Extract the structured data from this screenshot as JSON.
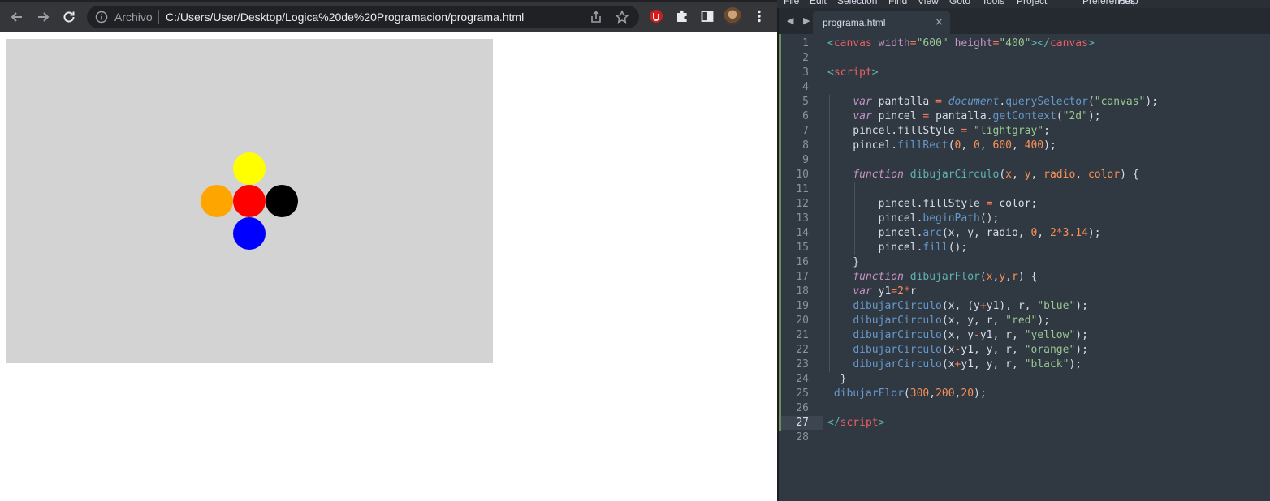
{
  "browser": {
    "omnibox": {
      "scheme_label": "Archivo",
      "url": "C:/Users/User/Desktop/Logica%20de%20Programacion/programa.html"
    },
    "canvas": {
      "background": "#d3d3d3",
      "circles": [
        {
          "name": "blue",
          "color": "#0000ff"
        },
        {
          "name": "red",
          "color": "#ff0000"
        },
        {
          "name": "yellow",
          "color": "#ffff00"
        },
        {
          "name": "orange",
          "color": "#ffa500"
        },
        {
          "name": "black",
          "color": "#000000"
        }
      ]
    }
  },
  "editor": {
    "menu": [
      "File",
      "Edit",
      "Selection",
      "Find",
      "View",
      "Goto",
      "Tools",
      "Project",
      "Preferences",
      "Help"
    ],
    "nav_arrows": "◀ ▶",
    "tab": {
      "name": "programa.html",
      "close": "×"
    },
    "active_line": 27,
    "lines": [
      {
        "n": "1",
        "tokens": [
          [
            "ang",
            "<"
          ],
          [
            "tagname",
            "canvas"
          ],
          [
            "pl",
            " "
          ],
          [
            "attr",
            "width"
          ],
          [
            "op",
            "="
          ],
          [
            "str",
            "\"600\""
          ],
          [
            "pl",
            " "
          ],
          [
            "attr",
            "height"
          ],
          [
            "op",
            "="
          ],
          [
            "str",
            "\"400\""
          ],
          [
            "ang",
            "></"
          ],
          [
            "tagname",
            "canvas"
          ],
          [
            "ang",
            ">"
          ]
        ]
      },
      {
        "n": "2",
        "tokens": []
      },
      {
        "n": "3",
        "tokens": [
          [
            "ang",
            "<"
          ],
          [
            "tagname",
            "script"
          ],
          [
            "ang",
            ">"
          ]
        ]
      },
      {
        "n": "4",
        "tokens": []
      },
      {
        "n": "5",
        "tokens": [
          [
            "pl",
            "    "
          ],
          [
            "kw",
            "var"
          ],
          [
            "pl",
            " pantalla "
          ],
          [
            "op",
            "="
          ],
          [
            "pl",
            " "
          ],
          [
            "dom",
            "document"
          ],
          [
            "pun",
            "."
          ],
          [
            "fn",
            "querySelector"
          ],
          [
            "pun",
            "("
          ],
          [
            "str",
            "\"canvas\""
          ],
          [
            "pun",
            ");"
          ]
        ]
      },
      {
        "n": "6",
        "tokens": [
          [
            "pl",
            "    "
          ],
          [
            "kw",
            "var"
          ],
          [
            "pl",
            " pincel "
          ],
          [
            "op",
            "="
          ],
          [
            "pl",
            " pantalla."
          ],
          [
            "fn",
            "getContext"
          ],
          [
            "pun",
            "("
          ],
          [
            "str",
            "\"2d\""
          ],
          [
            "pun",
            ");"
          ]
        ]
      },
      {
        "n": "7",
        "tokens": [
          [
            "pl",
            "    pincel.fillStyle "
          ],
          [
            "op",
            "="
          ],
          [
            "pl",
            " "
          ],
          [
            "str",
            "\"lightgray\""
          ],
          [
            "pun",
            ";"
          ]
        ]
      },
      {
        "n": "8",
        "tokens": [
          [
            "pl",
            "    pincel."
          ],
          [
            "fn",
            "fillRect"
          ],
          [
            "pun",
            "("
          ],
          [
            "num",
            "0"
          ],
          [
            "pun",
            ", "
          ],
          [
            "num",
            "0"
          ],
          [
            "pun",
            ", "
          ],
          [
            "num",
            "600"
          ],
          [
            "pun",
            ", "
          ],
          [
            "num",
            "400"
          ],
          [
            "pun",
            ");"
          ]
        ]
      },
      {
        "n": "9",
        "tokens": []
      },
      {
        "n": "10",
        "tokens": [
          [
            "pl",
            "    "
          ],
          [
            "kw",
            "function"
          ],
          [
            "pl",
            " "
          ],
          [
            "def",
            "dibujarCirculo"
          ],
          [
            "pun",
            "("
          ],
          [
            "par",
            "x"
          ],
          [
            "pun",
            ", "
          ],
          [
            "par",
            "y"
          ],
          [
            "pun",
            ", "
          ],
          [
            "par",
            "radio"
          ],
          [
            "pun",
            ", "
          ],
          [
            "par",
            "color"
          ],
          [
            "pun",
            ") {"
          ]
        ]
      },
      {
        "n": "11",
        "tokens": []
      },
      {
        "n": "12",
        "tokens": [
          [
            "pl",
            "        pincel.fillStyle "
          ],
          [
            "op",
            "="
          ],
          [
            "pl",
            " color;"
          ]
        ]
      },
      {
        "n": "13",
        "tokens": [
          [
            "pl",
            "        pincel."
          ],
          [
            "fn",
            "beginPath"
          ],
          [
            "pun",
            "();"
          ]
        ]
      },
      {
        "n": "14",
        "tokens": [
          [
            "pl",
            "        pincel."
          ],
          [
            "fn",
            "arc"
          ],
          [
            "pun",
            "("
          ],
          [
            "pl",
            "x, y, radio, "
          ],
          [
            "num",
            "0"
          ],
          [
            "pun",
            ", "
          ],
          [
            "num",
            "2"
          ],
          [
            "op",
            "*"
          ],
          [
            "num",
            "3.14"
          ],
          [
            "pun",
            ");"
          ]
        ]
      },
      {
        "n": "15",
        "tokens": [
          [
            "pl",
            "        pincel."
          ],
          [
            "fn",
            "fill"
          ],
          [
            "pun",
            "();"
          ]
        ]
      },
      {
        "n": "16",
        "tokens": [
          [
            "pl",
            "    }"
          ]
        ]
      },
      {
        "n": "17",
        "tokens": [
          [
            "pl",
            "    "
          ],
          [
            "kw",
            "function"
          ],
          [
            "pl",
            " "
          ],
          [
            "def",
            "dibujarFlor"
          ],
          [
            "pun",
            "("
          ],
          [
            "par",
            "x"
          ],
          [
            "pun",
            ","
          ],
          [
            "par",
            "y"
          ],
          [
            "pun",
            ","
          ],
          [
            "par",
            "r"
          ],
          [
            "pun",
            ") {"
          ]
        ]
      },
      {
        "n": "18",
        "tokens": [
          [
            "pl",
            "    "
          ],
          [
            "kw",
            "var"
          ],
          [
            "pl",
            " y1"
          ],
          [
            "op",
            "="
          ],
          [
            "num",
            "2"
          ],
          [
            "op",
            "*"
          ],
          [
            "pl",
            "r"
          ]
        ]
      },
      {
        "n": "19",
        "tokens": [
          [
            "pl",
            "    "
          ],
          [
            "fn",
            "dibujarCirculo"
          ],
          [
            "pun",
            "("
          ],
          [
            "pl",
            "x, (y"
          ],
          [
            "op",
            "+"
          ],
          [
            "pl",
            "y1), r, "
          ],
          [
            "str",
            "\"blue\""
          ],
          [
            "pun",
            ");"
          ]
        ]
      },
      {
        "n": "20",
        "tokens": [
          [
            "pl",
            "    "
          ],
          [
            "fn",
            "dibujarCirculo"
          ],
          [
            "pun",
            "("
          ],
          [
            "pl",
            "x, y, r, "
          ],
          [
            "str",
            "\"red\""
          ],
          [
            "pun",
            ");"
          ]
        ]
      },
      {
        "n": "21",
        "tokens": [
          [
            "pl",
            "    "
          ],
          [
            "fn",
            "dibujarCirculo"
          ],
          [
            "pun",
            "("
          ],
          [
            "pl",
            "x, y"
          ],
          [
            "op",
            "-"
          ],
          [
            "pl",
            "y1, r, "
          ],
          [
            "str",
            "\"yellow\""
          ],
          [
            "pun",
            ");"
          ]
        ]
      },
      {
        "n": "22",
        "tokens": [
          [
            "pl",
            "    "
          ],
          [
            "fn",
            "dibujarCirculo"
          ],
          [
            "pun",
            "("
          ],
          [
            "pl",
            "x"
          ],
          [
            "op",
            "-"
          ],
          [
            "pl",
            "y1, y, r, "
          ],
          [
            "str",
            "\"orange\""
          ],
          [
            "pun",
            ");"
          ]
        ]
      },
      {
        "n": "23",
        "tokens": [
          [
            "pl",
            "    "
          ],
          [
            "fn",
            "dibujarCirculo"
          ],
          [
            "pun",
            "("
          ],
          [
            "pl",
            "x"
          ],
          [
            "op",
            "+"
          ],
          [
            "pl",
            "y1, y, r, "
          ],
          [
            "str",
            "\"black\""
          ],
          [
            "pun",
            ");"
          ]
        ]
      },
      {
        "n": "24",
        "tokens": [
          [
            "pl",
            "  }"
          ]
        ]
      },
      {
        "n": "25",
        "tokens": [
          [
            "pl",
            " "
          ],
          [
            "fn",
            "dibujarFlor"
          ],
          [
            "pun",
            "("
          ],
          [
            "num",
            "300"
          ],
          [
            "pun",
            ","
          ],
          [
            "num",
            "200"
          ],
          [
            "pun",
            ","
          ],
          [
            "num",
            "20"
          ],
          [
            "pun",
            ");"
          ]
        ]
      },
      {
        "n": "26",
        "tokens": []
      },
      {
        "n": "27",
        "tokens": [
          [
            "ang",
            "</"
          ],
          [
            "tagname",
            "script"
          ],
          [
            "ang",
            ">"
          ]
        ]
      },
      {
        "n": "28",
        "tokens": []
      }
    ]
  }
}
